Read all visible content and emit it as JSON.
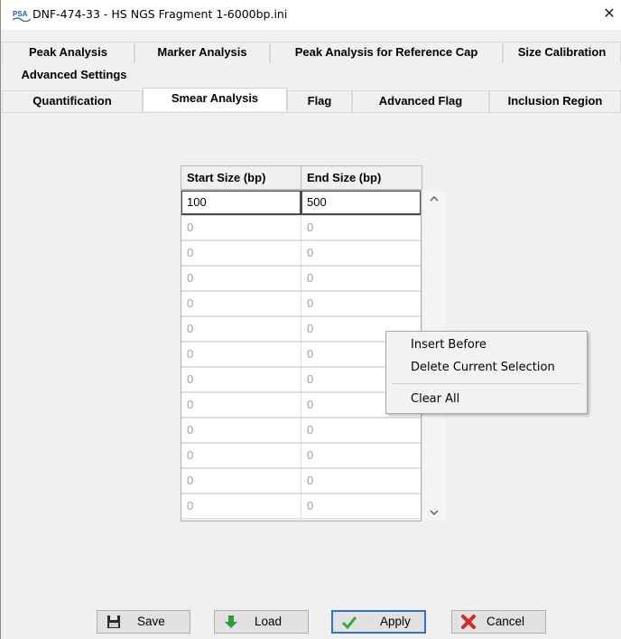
{
  "window": {
    "title": "DNF-474-33 - HS NGS Fragment 1-6000bp.ini",
    "close_glyph": "✕",
    "app_icon": "psa-logo-icon"
  },
  "tabs": {
    "row1": [
      {
        "label": "Peak Analysis"
      },
      {
        "label": "Marker Analysis"
      },
      {
        "label": "Peak Analysis for Reference Cap"
      },
      {
        "label": "Size Calibration"
      }
    ],
    "row2": [
      {
        "label": "Advanced Settings"
      }
    ],
    "row3": [
      {
        "label": "Quantification"
      },
      {
        "label": "Smear Analysis",
        "active": true
      },
      {
        "label": "Flag"
      },
      {
        "label": "Advanced Flag"
      },
      {
        "label": "Inclusion Region"
      }
    ]
  },
  "table": {
    "headers": [
      "Start Size (bp)",
      "End Size (bp)"
    ],
    "rows": [
      [
        "100",
        "500"
      ],
      [
        "0",
        "0"
      ],
      [
        "0",
        "0"
      ],
      [
        "0",
        "0"
      ],
      [
        "0",
        "0"
      ],
      [
        "0",
        "0"
      ],
      [
        "0",
        "0"
      ],
      [
        "0",
        "0"
      ],
      [
        "0",
        "0"
      ],
      [
        "0",
        "0"
      ],
      [
        "0",
        "0"
      ],
      [
        "0",
        "0"
      ],
      [
        "0",
        "0"
      ]
    ],
    "scroll_up": "^",
    "scroll_down": "v"
  },
  "context_menu": {
    "items": [
      "Insert Before",
      "Delete Current Selection",
      "Clear All"
    ]
  },
  "buttons": {
    "save": "Save",
    "load": "Load",
    "apply": "Apply",
    "cancel": "Cancel"
  },
  "colors": {
    "accent": "#2f72d4",
    "cancel_red": "#d9262b",
    "apply_green": "#3aa83a",
    "load_green": "#2f9c3a"
  }
}
